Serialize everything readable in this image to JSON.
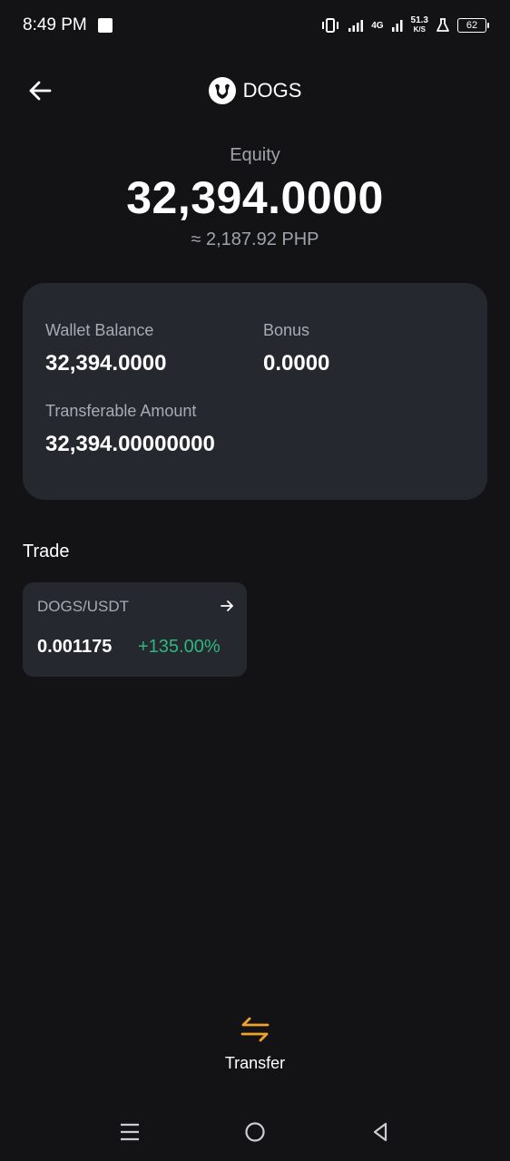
{
  "status_bar": {
    "time": "8:49 PM",
    "network": "4G",
    "net_speed_value": "51.3",
    "net_speed_unit": "K/S",
    "battery": "62"
  },
  "header": {
    "title": "DOGS",
    "back_icon": "arrow-left-icon",
    "coin_icon": "dog-logo-icon"
  },
  "equity": {
    "label": "Equity",
    "value": "32,394.0000",
    "fiat": "≈ 2,187.92 PHP"
  },
  "balance_card": {
    "wallet_balance_label": "Wallet Balance",
    "wallet_balance_value": "32,394.0000",
    "bonus_label": "Bonus",
    "bonus_value": "0.0000",
    "transferable_label": "Transferable Amount",
    "transferable_value": "32,394.00000000"
  },
  "trade": {
    "title": "Trade",
    "pairs": [
      {
        "name": "DOGS/USDT",
        "price": "0.001175",
        "change": "+135.00%",
        "change_color": "#2fb67d"
      }
    ]
  },
  "transfer": {
    "label": "Transfer",
    "icon": "transfer-arrows-icon",
    "icon_color": "#f0a32b"
  },
  "nav": {
    "menu_icon": "menu-icon",
    "home_icon": "home-circle-icon",
    "back_icon": "back-triangle-icon"
  }
}
